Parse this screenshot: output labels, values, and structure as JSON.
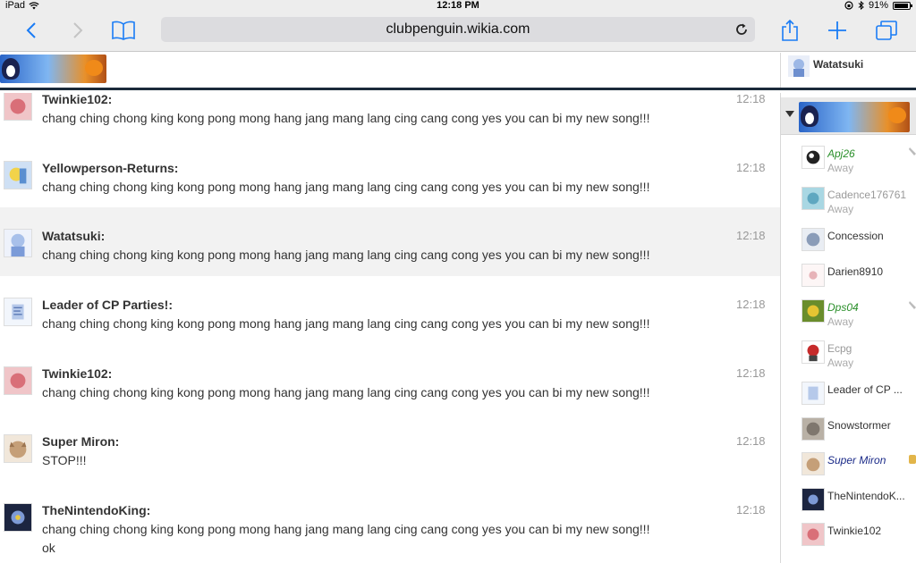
{
  "status": {
    "device": "iPad",
    "time": "12:18 PM",
    "battery": "91%",
    "battery_level": 0.91
  },
  "browser": {
    "url": "clubpenguin.wikia.com"
  },
  "header": {
    "current_user": "Watatsuki"
  },
  "messages": [
    {
      "user": "Twinkie102:",
      "text": "chang ching chong king kong pong mong hang jang mang lang cing cang cong yes you can bi my new song!!!",
      "time": "12:18"
    },
    {
      "user": "Yellowperson-Returns:",
      "text": "chang ching chong king kong pong mong hang jang mang lang cing cang cong yes you can bi my new song!!!",
      "time": "12:18"
    },
    {
      "user": "Watatsuki:",
      "text": "chang ching chong king kong pong mong hang jang mang lang cing cang cong yes you can bi my new song!!!",
      "time": "12:18"
    },
    {
      "user": "Leader of CP Parties!:",
      "text": "chang ching chong king kong pong mong hang jang mang lang cing cang cong yes you can bi my new song!!!",
      "time": "12:18"
    },
    {
      "user": "Twinkie102:",
      "text": "chang ching chong king kong pong mong hang jang mang lang cing cang cong yes you can bi my new song!!!",
      "time": "12:18"
    },
    {
      "user": "Super Miron:",
      "text": "STOP!!!",
      "time": "12:18"
    },
    {
      "user": "TheNintendoKing:",
      "text": "chang ching chong king kong pong mong hang jang mang lang cing cang cong yes you can bi my new song!!!",
      "text2": "ok",
      "time": "12:18"
    }
  ],
  "users": [
    {
      "name": "Apj26",
      "status": "Away"
    },
    {
      "name": "Cadence176761",
      "status": "Away"
    },
    {
      "name": "Concession",
      "status": ""
    },
    {
      "name": "Darien8910",
      "status": ""
    },
    {
      "name": "Dps04",
      "status": "Away"
    },
    {
      "name": "Ecpg",
      "status": "Away"
    },
    {
      "name": "Leader of CP ...",
      "status": ""
    },
    {
      "name": "Snowstormer",
      "status": ""
    },
    {
      "name": "Super Miron",
      "status": ""
    },
    {
      "name": "TheNintendoK...",
      "status": ""
    },
    {
      "name": "Twinkie102",
      "status": ""
    }
  ]
}
